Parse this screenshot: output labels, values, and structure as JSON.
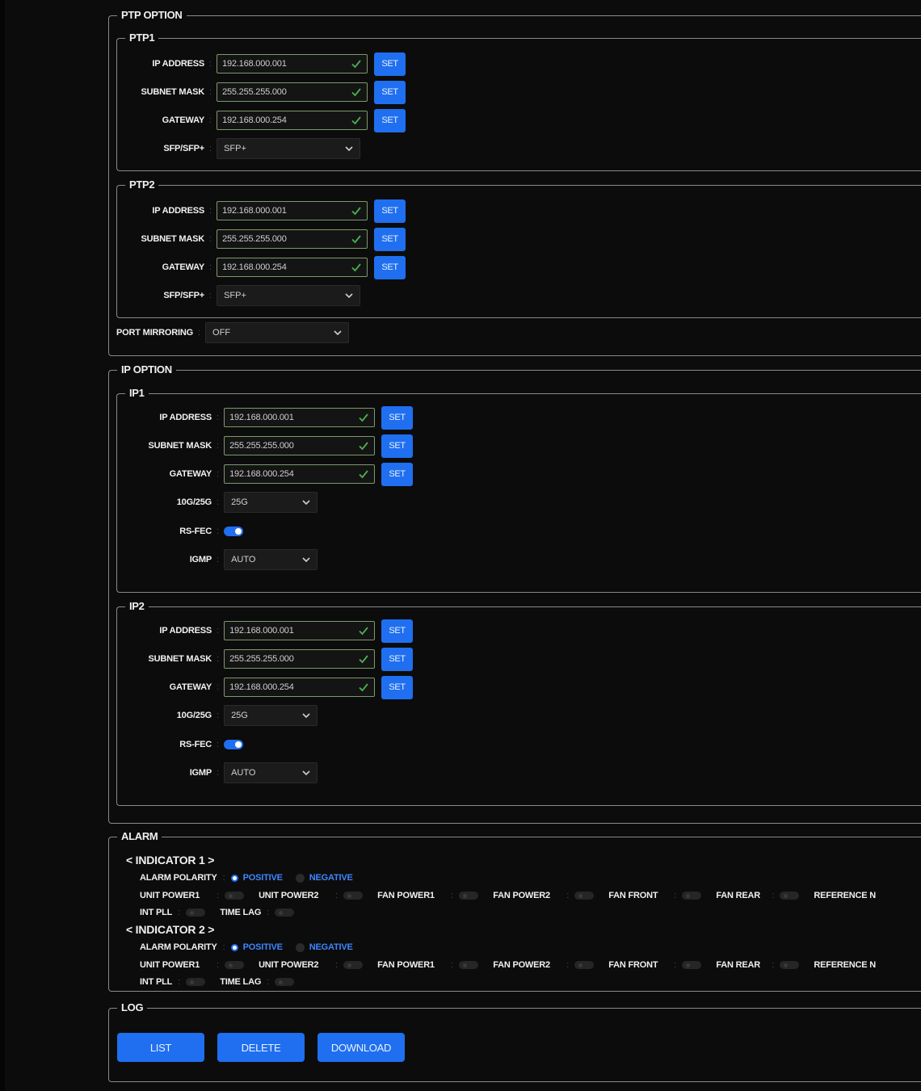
{
  "ptp_option": {
    "title": "PTP OPTION",
    "ptp1": {
      "title": "PTP1",
      "ip_address": {
        "label": "IP ADDRESS",
        "value": "192.168.000.001",
        "button": "SET"
      },
      "subnet_mask": {
        "label": "SUBNET MASK",
        "value": "255.255.255.000",
        "button": "SET"
      },
      "gateway": {
        "label": "GATEWAY",
        "value": "192.168.000.254",
        "button": "SET"
      },
      "sfp": {
        "label": "SFP/SFP+",
        "value": "SFP+"
      }
    },
    "ptp2": {
      "title": "PTP2",
      "ip_address": {
        "label": "IP ADDRESS",
        "value": "192.168.000.001",
        "button": "SET"
      },
      "subnet_mask": {
        "label": "SUBNET MASK",
        "value": "255.255.255.000",
        "button": "SET"
      },
      "gateway": {
        "label": "GATEWAY",
        "value": "192.168.000.254",
        "button": "SET"
      },
      "sfp": {
        "label": "SFP/SFP+",
        "value": "SFP+"
      }
    },
    "port_mirroring": {
      "label": "PORT MIRRORING",
      "value": "OFF"
    }
  },
  "ip_option": {
    "title": "IP OPTION",
    "ip1": {
      "title": "IP1",
      "ip_address": {
        "label": "IP ADDRESS",
        "value": "192.168.000.001",
        "button": "SET"
      },
      "subnet_mask": {
        "label": "SUBNET MASK",
        "value": "255.255.255.000",
        "button": "SET"
      },
      "gateway": {
        "label": "GATEWAY",
        "value": "192.168.000.254",
        "button": "SET"
      },
      "speed": {
        "label": "10G/25G",
        "value": "25G"
      },
      "rsfec": {
        "label": "RS-FEC",
        "enabled": true
      },
      "igmp": {
        "label": "IGMP",
        "value": "AUTO"
      }
    },
    "ip2": {
      "title": "IP2",
      "ip_address": {
        "label": "IP ADDRESS",
        "value": "192.168.000.001",
        "button": "SET"
      },
      "subnet_mask": {
        "label": "SUBNET MASK",
        "value": "255.255.255.000",
        "button": "SET"
      },
      "gateway": {
        "label": "GATEWAY",
        "value": "192.168.000.254",
        "button": "SET"
      },
      "speed": {
        "label": "10G/25G",
        "value": "25G"
      },
      "rsfec": {
        "label": "RS-FEC",
        "enabled": true
      },
      "igmp": {
        "label": "IGMP",
        "value": "AUTO"
      }
    }
  },
  "alarm": {
    "title": "ALARM",
    "polarity_label": "ALARM POLARITY",
    "positive_label": "POSITIVE",
    "negative_label": "NEGATIVE",
    "indicator1": {
      "title": "< INDICATOR 1 >",
      "polarity": "POSITIVE",
      "items_row1": [
        "UNIT POWER1",
        "UNIT POWER2",
        "FAN POWER1",
        "FAN POWER2",
        "FAN FRONT",
        "FAN REAR",
        "REFERENCE N"
      ],
      "items_row2": [
        "INT PLL",
        "TIME LAG"
      ]
    },
    "indicator2": {
      "title": "< INDICATOR 2 >",
      "polarity": "POSITIVE",
      "items_row1": [
        "UNIT POWER1",
        "UNIT POWER2",
        "FAN POWER1",
        "FAN POWER2",
        "FAN FRONT",
        "FAN REAR",
        "REFERENCE N"
      ],
      "items_row2": [
        "INT PLL",
        "TIME LAG"
      ]
    }
  },
  "log": {
    "title": "LOG",
    "list_label": "LIST",
    "delete_label": "DELETE",
    "download_label": "DOWNLOAD"
  },
  "colors": {
    "accent": "#1f6ff0",
    "background": "#0c0c0c",
    "positive": "#3d86ff",
    "check": "#4caf50"
  }
}
